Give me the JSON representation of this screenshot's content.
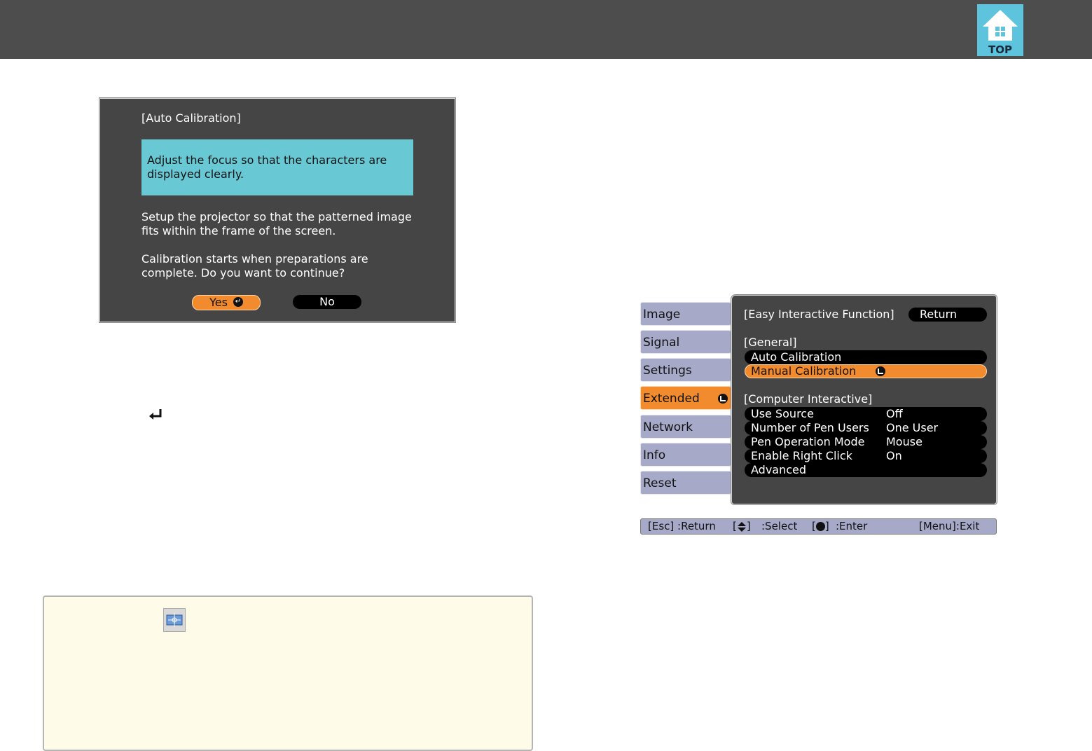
{
  "header": {
    "top_label": "TOP"
  },
  "dialog": {
    "title": "[Auto Calibration]",
    "highlight": "Adjust the focus so that the characters are displayed clearly.",
    "para1": "Setup the projector so that the patterned image fits within the frame of the screen.",
    "para2": "Calibration starts when preparations are complete. Do you want to continue?",
    "yes_label": "Yes",
    "no_label": "No"
  },
  "menu": {
    "tabs": [
      "Image",
      "Signal",
      "Settings",
      "Extended",
      "Network",
      "Info",
      "Reset"
    ],
    "active_tab": "Extended",
    "panel_title": "[Easy Interactive Function]",
    "return_label": "Return",
    "section_general": "[General]",
    "general_items": [
      "Auto Calibration",
      "Manual Calibration"
    ],
    "section_computer": "[Computer Interactive]",
    "computer_items": [
      {
        "label": "Use Source",
        "value": "Off"
      },
      {
        "label": "Number of Pen Users",
        "value": "One User"
      },
      {
        "label": "Pen Operation Mode",
        "value": "Mouse"
      },
      {
        "label": "Enable Right Click",
        "value": "On"
      },
      {
        "label": "Advanced",
        "value": ""
      }
    ],
    "help": {
      "esc": "[Esc] :Return",
      "select": ":Select",
      "enter": ":Enter",
      "exit": "[Menu]:Exit"
    }
  },
  "colors": {
    "accent": "#f28a2e",
    "tab": "#a6a9c8",
    "panel": "#454545",
    "highlight": "#68c9d5",
    "topbar": "#4d4d4d"
  }
}
